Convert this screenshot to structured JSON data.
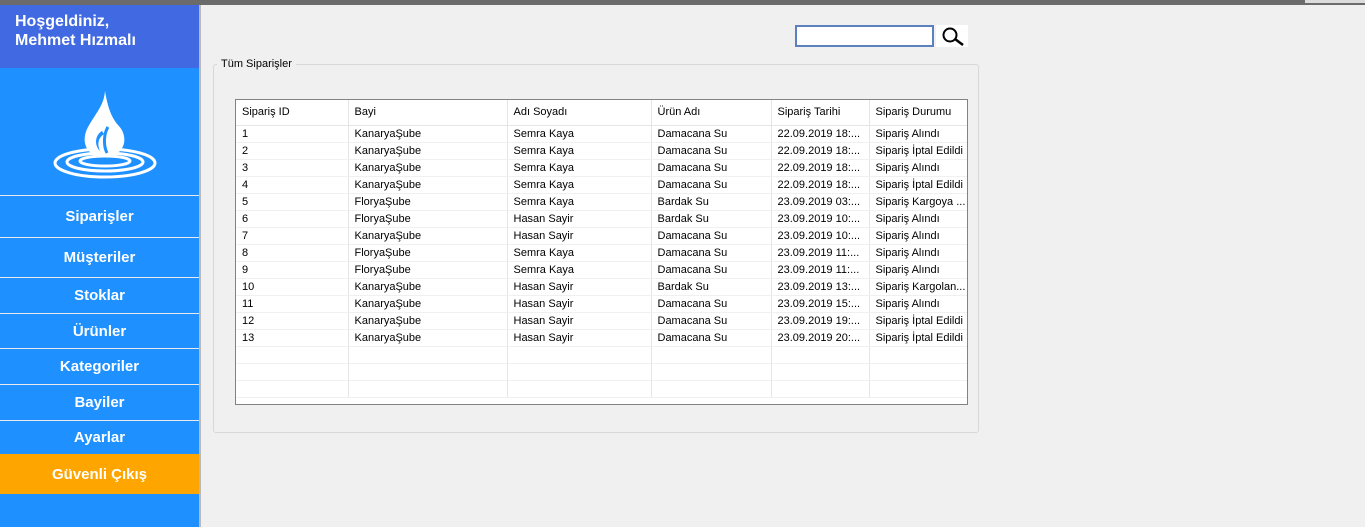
{
  "welcome": {
    "line1": "Hoşgeldiniz,",
    "line2": "Mehmet Hızmalı"
  },
  "sidebar": {
    "items": [
      {
        "label": "Siparişler"
      },
      {
        "label": "Müşteriler"
      },
      {
        "label": "Stoklar"
      },
      {
        "label": "Ürünler"
      },
      {
        "label": "Kategoriler"
      },
      {
        "label": "Bayiler"
      },
      {
        "label": "Ayarlar"
      },
      {
        "label": "Güvenli Çıkış"
      }
    ]
  },
  "search": {
    "value": "",
    "icon": "search-icon"
  },
  "orders": {
    "group_title": "Tüm Siparişler",
    "columns": [
      "Sipariş ID",
      "Bayi",
      "Adı Soyadı",
      "Ürün Adı",
      "Sipariş Tarihi",
      "Sipariş Durumu"
    ],
    "rows": [
      [
        "1",
        "KanaryaŞube",
        "Semra Kaya",
        "Damacana Su",
        "22.09.2019 18:...",
        "Sipariş Alındı"
      ],
      [
        "2",
        "KanaryaŞube",
        "Semra Kaya",
        "Damacana Su",
        "22.09.2019 18:...",
        "Sipariş İptal Edildi"
      ],
      [
        "3",
        "KanaryaŞube",
        "Semra Kaya",
        "Damacana Su",
        "22.09.2019 18:...",
        "Sipariş Alındı"
      ],
      [
        "4",
        "KanaryaŞube",
        "Semra Kaya",
        "Damacana Su",
        "22.09.2019 18:...",
        "Sipariş İptal Edildi"
      ],
      [
        "5",
        "FloryaŞube",
        "Semra Kaya",
        "Bardak Su",
        "23.09.2019 03:...",
        "Sipariş Kargoya ..."
      ],
      [
        "6",
        "FloryaŞube",
        "Hasan Sayir",
        "Bardak Su",
        "23.09.2019 10:...",
        "Sipariş Alındı"
      ],
      [
        "7",
        "KanaryaŞube",
        "Hasan Sayir",
        "Damacana Su",
        "23.09.2019 10:...",
        "Sipariş Alındı"
      ],
      [
        "8",
        "FloryaŞube",
        "Semra Kaya",
        "Damacana Su",
        "23.09.2019 11:...",
        "Sipariş Alındı"
      ],
      [
        "9",
        "FloryaŞube",
        "Semra Kaya",
        "Damacana Su",
        "23.09.2019 11:...",
        "Sipariş Alındı"
      ],
      [
        "10",
        "KanaryaŞube",
        "Hasan Sayir",
        "Bardak Su",
        "23.09.2019 13:...",
        "Sipariş Kargolan..."
      ],
      [
        "11",
        "KanaryaŞube",
        "Hasan Sayir",
        "Damacana Su",
        "23.09.2019 15:...",
        "Sipariş Alındı"
      ],
      [
        "12",
        "KanaryaŞube",
        "Hasan Sayir",
        "Damacana Su",
        "23.09.2019 19:...",
        "Sipariş İptal Edildi"
      ],
      [
        "13",
        "KanaryaŞube",
        "Hasan Sayir",
        "Damacana Su",
        "23.09.2019 20:...",
        "Sipariş İptal Edildi"
      ]
    ]
  },
  "colors": {
    "sidebar": "#1e90ff",
    "header": "#4169e1",
    "exit": "#ffa500"
  }
}
